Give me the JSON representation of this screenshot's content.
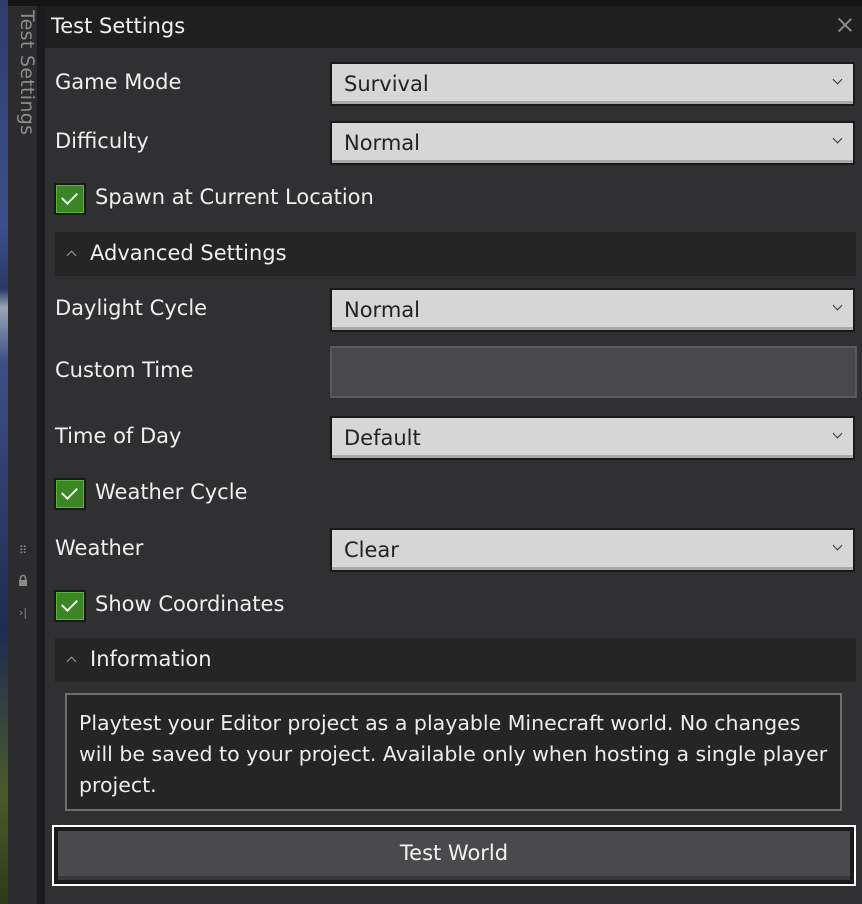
{
  "side_tab": {
    "label": "Test Settings"
  },
  "panel": {
    "title": "Test Settings",
    "game_mode": {
      "label": "Game Mode",
      "value": "Survival"
    },
    "difficulty": {
      "label": "Difficulty",
      "value": "Normal"
    },
    "spawn_current": {
      "label": "Spawn at Current Location",
      "checked": true
    },
    "advanced_section": {
      "label": "Advanced Settings",
      "expanded": true
    },
    "daylight_cycle": {
      "label": "Daylight Cycle",
      "value": "Normal"
    },
    "custom_time": {
      "label": "Custom Time",
      "value": ""
    },
    "time_of_day": {
      "label": "Time of Day",
      "value": "Default"
    },
    "weather_cycle": {
      "label": "Weather Cycle",
      "checked": true
    },
    "weather": {
      "label": "Weather",
      "value": "Clear"
    },
    "show_coordinates": {
      "label": "Show Coordinates",
      "checked": true
    },
    "information_section": {
      "label": "Information",
      "expanded": true
    },
    "info_text": "Playtest your Editor project as a playable Minecraft world. No changes will be saved to your project. Available only when hosting a single player project.",
    "test_world_button": "Test World"
  },
  "colors": {
    "panel_bg": "#303032",
    "title_bg": "#1f1f20",
    "dropdown_bg": "#d6d6d6",
    "checkbox_green": "#3c8527",
    "button_bg": "#4a4a4c"
  },
  "icons": {
    "drag_handle": "drag-handle-icon",
    "lock": "lock-icon",
    "collapse": "collapse-panel-icon",
    "close": "close-icon",
    "dropdown": "chevron-down-icon",
    "section_toggle": "chevron-up-icon",
    "checkbox": "checkmark-icon"
  }
}
